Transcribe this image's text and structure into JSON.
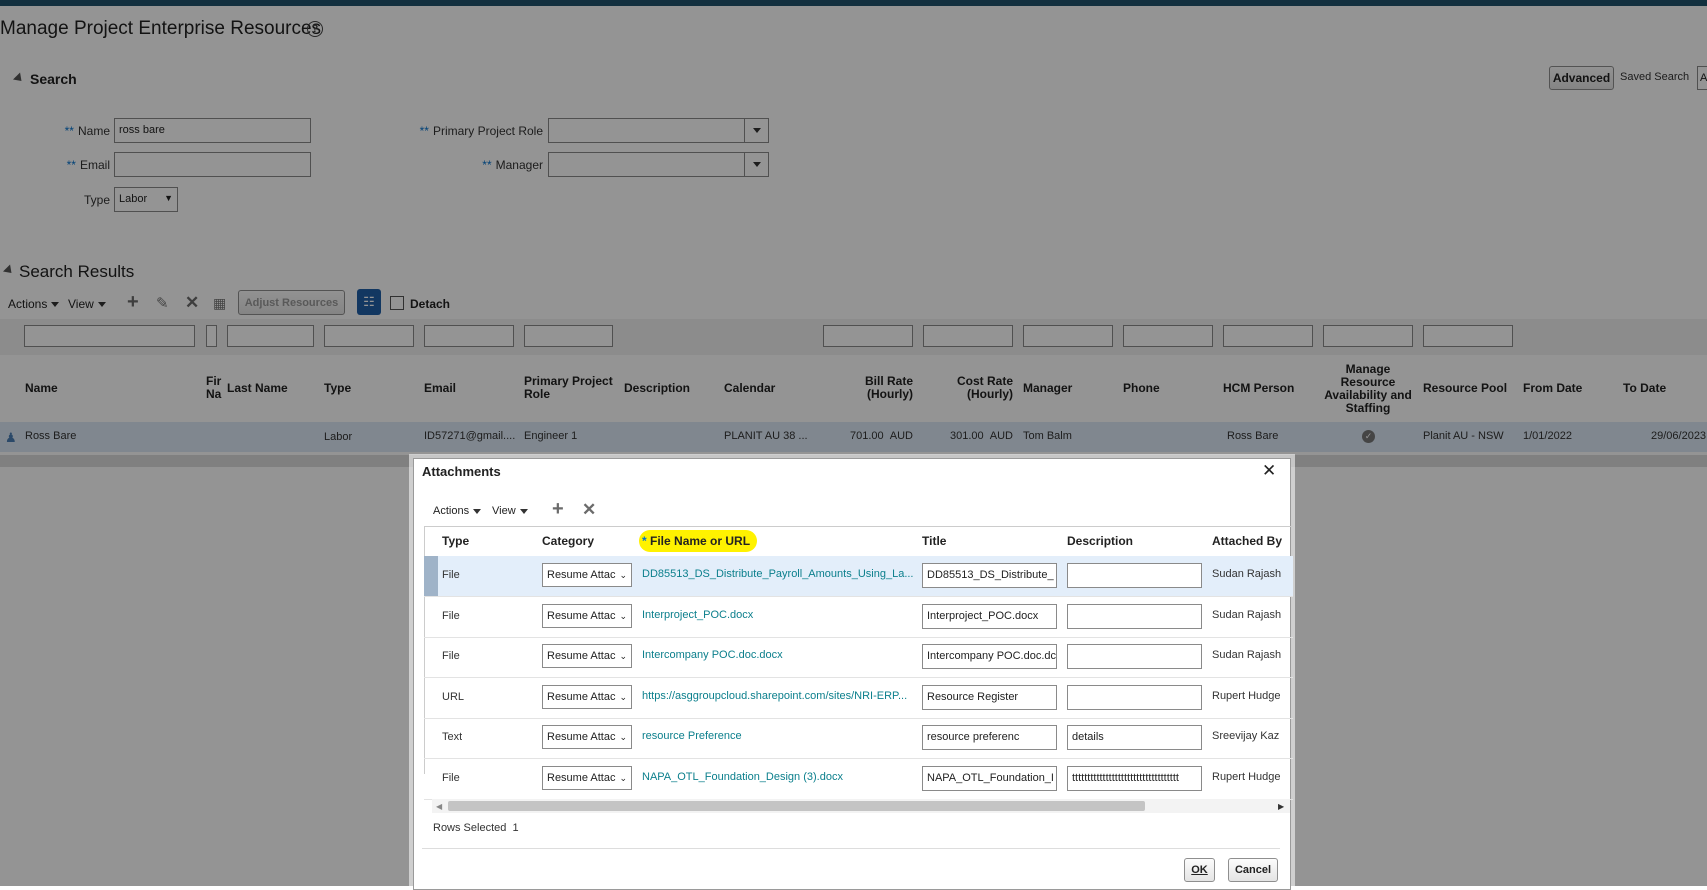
{
  "page": {
    "title": "Manage Project Enterprise Resources",
    "help_icon": "question-circle-icon"
  },
  "search": {
    "header": "Search",
    "advanced_label": "Advanced",
    "saved_search_label": "Saved Search",
    "saved_search_value": "A",
    "required_mark": "**",
    "fields": {
      "name_label": "Name",
      "name_value": "ross bare",
      "email_label": "Email",
      "email_value": "",
      "type_label": "Type",
      "type_value": "Labor",
      "role_label": "Primary Project Role",
      "role_value": "",
      "manager_label": "Manager",
      "manager_value": ""
    }
  },
  "results": {
    "header": "Search Results",
    "toolbar": {
      "actions": "Actions",
      "view": "View",
      "adjust": "Adjust Resources",
      "detach": "Detach"
    },
    "columns": {
      "name": "Name",
      "first_name_a": "Fir",
      "first_name_b": "Na",
      "last_name": "Last Name",
      "type": "Type",
      "email": "Email",
      "role_a": "Primary Project",
      "role_b": "Role",
      "description": "Description",
      "calendar": "Calendar",
      "bill_a": "Bill Rate",
      "bill_b": "(Hourly)",
      "cost_a": "Cost Rate",
      "cost_b": "(Hourly)",
      "manager": "Manager",
      "phone": "Phone",
      "hcm": "HCM Person",
      "manage_a": "Manage",
      "manage_b": "Resource",
      "manage_c": "Availability and",
      "manage_d": "Staffing",
      "pool": "Resource Pool",
      "from": "From Date",
      "to": "To Date"
    },
    "row": {
      "name": "Ross Bare",
      "type": "Labor",
      "email": "ID57271@gmail....",
      "role": "Engineer 1",
      "calendar": "PLANIT AU 38 ...",
      "bill_rate": "701.00",
      "bill_cur": "AUD",
      "cost_rate": "301.00",
      "cost_cur": "AUD",
      "manager": "Tom Balm",
      "hcm": "Ross Bare",
      "pool": "Planit AU - NSW",
      "from": "1/01/2022",
      "to": "29/06/2023"
    }
  },
  "dialog": {
    "title": "Attachments",
    "toolbar": {
      "actions": "Actions",
      "view": "View"
    },
    "columns": {
      "type": "Type",
      "category": "Category",
      "file_req": "*",
      "file": "File Name or URL",
      "title": "Title",
      "description": "Description",
      "attached_by": "Attached By"
    },
    "rows": [
      {
        "type": "File",
        "category": "Resume Attac",
        "file": "DD85513_DS_Distribute_Payroll_Amounts_Using_La...",
        "title": "DD85513_DS_Distribute_",
        "description": "",
        "attached_by": "Sudan Rajash"
      },
      {
        "type": "File",
        "category": "Resume Attac",
        "file": "Interproject_POC.docx",
        "title": "Interproject_POC.docx",
        "description": "",
        "attached_by": "Sudan Rajash"
      },
      {
        "type": "File",
        "category": "Resume Attac",
        "file": "Intercompany POC.doc.docx",
        "title": "Intercompany POC.doc.dc",
        "description": "",
        "attached_by": "Sudan Rajash"
      },
      {
        "type": "URL",
        "category": "Resume Attac",
        "file": "https://asggroupcloud.sharepoint.com/sites/NRI-ERP...",
        "title": "Resource Register",
        "description": "",
        "attached_by": "Rupert Hudge"
      },
      {
        "type": "Text",
        "category": "Resume Attac",
        "file": "resource Preference",
        "title": "resource preferenc",
        "description": "details",
        "attached_by": "Sreevijay Kaz"
      },
      {
        "type": "File",
        "category": "Resume Attac",
        "file": "NAPA_OTL_Foundation_Design (3).docx",
        "title": "NAPA_OTL_Foundation_I",
        "description": "ttttttttttttttttttttttttttttttttttt",
        "attached_by": "Rupert Hudge"
      }
    ],
    "rows_selected_label": "Rows Selected",
    "rows_selected_value": "1",
    "ok_label": "OK",
    "cancel_label": "Cancel",
    "close_icon": "close-icon"
  },
  "colors": {
    "link": "#0b7f8c",
    "highlight": "#fff200",
    "topbar": "#13303f",
    "selected_row": "#e0ecf8"
  }
}
